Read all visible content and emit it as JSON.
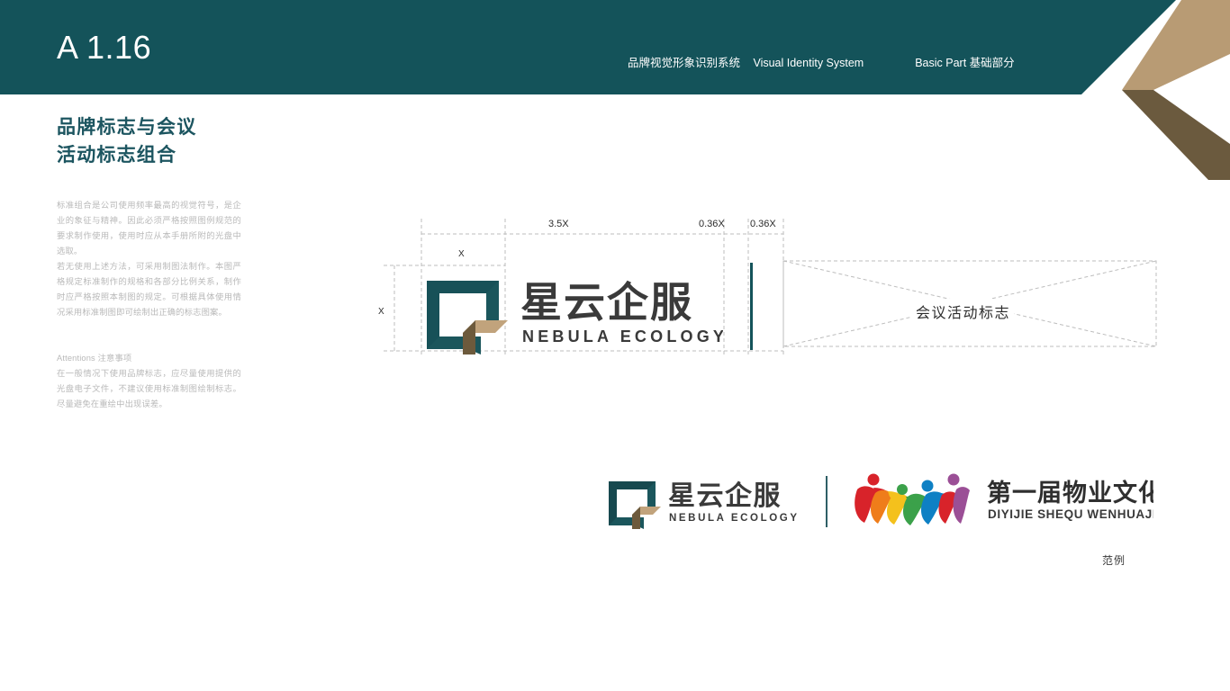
{
  "header": {
    "code": "A 1.16",
    "system_cn": "品牌视觉形象识别系统",
    "system_en": "Visual Identity System",
    "section": "Basic Part 基础部分",
    "bar_color": "#14535a",
    "chevron_light": "#b89b74",
    "chevron_dark": "#6b5a3e"
  },
  "sidebar": {
    "title": "品牌标志与会议\n活动标志组合",
    "title_color": "#1c5560",
    "paragraph_1": "标准组合是公司使用频率最高的视觉符号，是企业的象征与精神。因此必须严格按照图例规范的要求制作使用，使用时应从本手册所附的光盘中选取。",
    "paragraph_2": "若无使用上述方法，可采用制图法制作。本图严格规定标准制作的规格和各部分比例关系，制作时应严格按照本制图的规定。可根据具体使用情况采用标准制图即可绘制出正确的标志图案。",
    "attentions_title": "Attentions 注意事项",
    "attentions_body": "在一般情况下使用品牌标志，应尽量使用提供的光盘电子文件，不建议使用标准制图绘制标志。尽量避免在重绘中出现误差。"
  },
  "diagram": {
    "dim_width_logo": "3.5X",
    "dim_gap_1": "0.36X",
    "dim_gap_2": "0.36X",
    "dim_x_top": "X",
    "dim_x_left": "X",
    "placeholder_label": "会议活动标志",
    "brand_cn": "星云企服",
    "brand_en": "NEBULA ECOLOGY",
    "mark_color_teal": "#1b565c",
    "mark_color_tan": "#c1a37c",
    "mark_color_brown": "#6d5a3c",
    "divider_color": "#14535a",
    "guide_color": "#bdbdbd"
  },
  "example": {
    "brand_cn": "星云企服",
    "brand_en": "NEBULA ECOLOGY",
    "festival_cn": "第一届物业文化节",
    "festival_en": "DIYIJIE SHEQU WENHUAJIE",
    "caption": "范例",
    "figure_colors": [
      "#d8232a",
      "#ef7d1a",
      "#f4c11c",
      "#3ba14a",
      "#0e80c4",
      "#9b4f96"
    ]
  }
}
